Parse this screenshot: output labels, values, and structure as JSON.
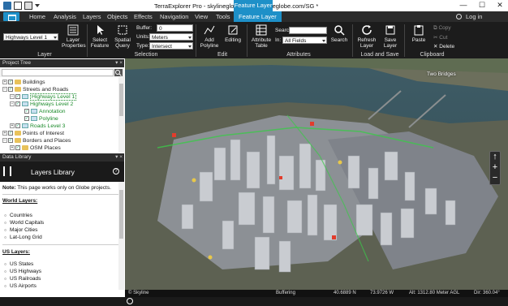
{
  "window": {
    "title": "TerraExplorer Pro - skylineglobe.tbp@skylineglobe.com/SG *",
    "context_tab_title": "Feature Layer",
    "minimize": "—",
    "maximize": "☐",
    "close": "✕"
  },
  "ribbon_tabs": [
    "Home",
    "Analysis",
    "Layers",
    "Objects",
    "Effects",
    "Navigation",
    "View",
    "Tools",
    "Feature Layer"
  ],
  "login": "Log in",
  "ribbon": {
    "layer": {
      "selected_layer": "Highways Level 1",
      "properties_label": "Layer Properties",
      "group_label": "Layer"
    },
    "selection": {
      "select_feature": "Select Feature",
      "spatial_query": "Spatial Query",
      "buffer_label": "Buffer:",
      "buffer_value": "0",
      "units_label": "Units:",
      "units_value": "Meters",
      "type_label": "Type:",
      "type_value": "Intersect",
      "group_label": "Selection"
    },
    "edit": {
      "add_polyline": "Add Polyline",
      "editing": "Editing",
      "group_label": "Edit"
    },
    "attributes": {
      "attribute_table": "Attribute Table",
      "search_label": "Search:",
      "search_value": "",
      "in_label": "In:",
      "in_value": "All Fields",
      "search_button": "Search",
      "group_label": "Attributes"
    },
    "load_save": {
      "refresh_layer": "Refresh Layer",
      "save_layer": "Save Layer",
      "group_label": "Load and Save"
    },
    "clipboard": {
      "paste": "Paste",
      "copy": "Copy",
      "cut": "Cut",
      "delete": "Delete",
      "group_label": "Clipboard"
    }
  },
  "project_tree": {
    "header": "Project Tree",
    "header_controls": "▾ ×",
    "nodes": [
      {
        "label": "Buildings",
        "expander": "+"
      },
      {
        "label": "Streets and Roads",
        "expander": "−"
      },
      {
        "label": "Highways Level 1",
        "expander": "−"
      },
      {
        "label": "Highways Level 2",
        "expander": "−"
      },
      {
        "label": "Annotation",
        "expander": ""
      },
      {
        "label": "Polyline",
        "expander": ""
      },
      {
        "label": "Roads Level 3",
        "expander": "+"
      },
      {
        "label": "Points of Interest",
        "expander": "+"
      },
      {
        "label": "Borders and Places",
        "expander": "−"
      },
      {
        "label": "OSM Places",
        "expander": "+"
      }
    ]
  },
  "data_library": {
    "header": "Data Library",
    "header_controls": "▾ ×",
    "title": "Layers Library",
    "help": "?",
    "note_bold": "Note:",
    "note_text": " This page works only on Globe projects.",
    "world_layers_heading": "World Layers:",
    "world_layers": [
      "Countries",
      "World Capitals",
      "Major Cities",
      "Lat-Long Grid"
    ],
    "us_layers_heading": "US Layers:",
    "us_layers": [
      "US States",
      "US Highways",
      "US Railroads",
      "US Airports"
    ]
  },
  "map": {
    "labels": {
      "two_bridges": "Two Bridges"
    },
    "nav": {
      "north": "↑",
      "zoom_in": "+",
      "zoom_out": "−"
    }
  },
  "status_bar": {
    "brand": "© Skyline",
    "buffering": "Buffering",
    "lat": "40.6889 N",
    "lon": "73.9726 W",
    "alt": "Alt: 1312.80 Meter AGL",
    "dir": "Dir: 360.04°"
  },
  "colors": {
    "accent": "#1e90c8",
    "ribbon_bg": "#1c1c1c",
    "tree_highlight": "#1a8a2a"
  }
}
